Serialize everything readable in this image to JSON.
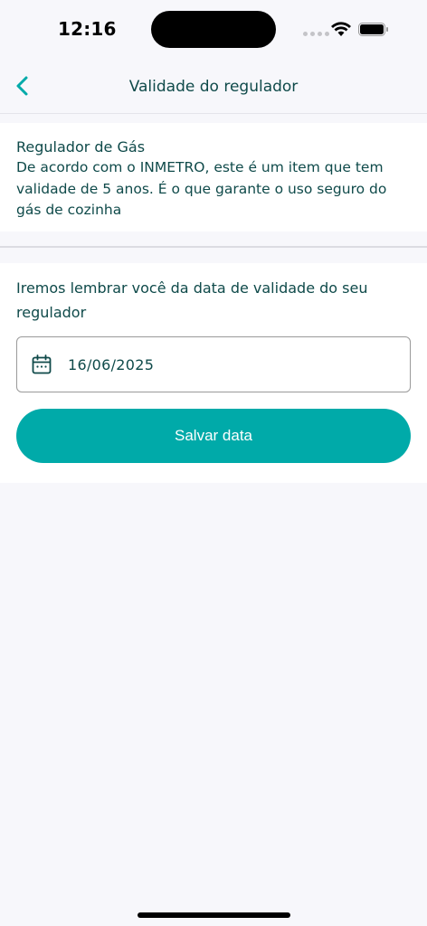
{
  "status_bar": {
    "time": "12:16"
  },
  "nav": {
    "back_icon": "chevron-left-icon",
    "title": "Validade do regulador"
  },
  "info": {
    "title": "Regulador de Gás",
    "lines": [
      "De acordo com o INMETRO, este é um item que tem",
      "validade de 5 anos. É o que garante o uso seguro do",
      "gás de cozinha"
    ]
  },
  "form": {
    "description_lines": [
      "Iremos lembrar você da data de validade do seu",
      "regulador"
    ],
    "date_icon": "calendar-icon",
    "date_value": "16/06/2025",
    "save_label": "Salvar data"
  },
  "colors": {
    "accent": "#00aaa9",
    "text": "#0f4a4a",
    "background": "#f7f7fb"
  }
}
